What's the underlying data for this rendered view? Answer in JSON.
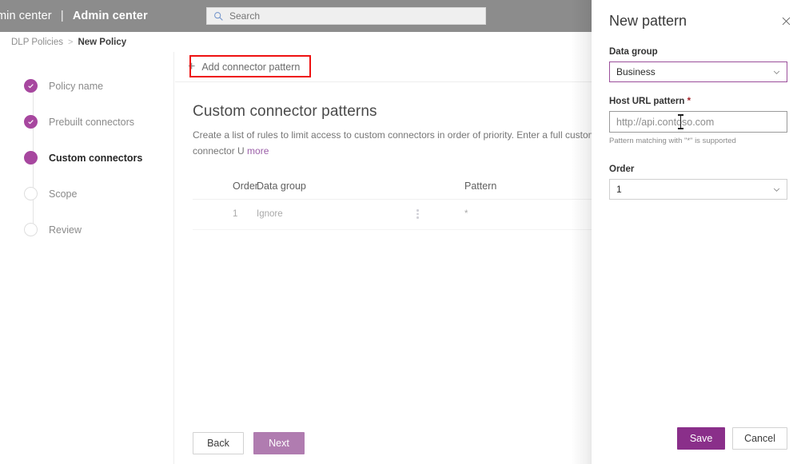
{
  "suite": {
    "title_truncated": "min center",
    "divider": "|",
    "title_bold": "Admin center"
  },
  "search": {
    "placeholder": "Search",
    "icon": "search-icon"
  },
  "breadcrumb": {
    "parent": "DLP Policies",
    "separator": ">",
    "current": "New Policy"
  },
  "wizard": {
    "steps": [
      {
        "label": "Policy name",
        "state": "done"
      },
      {
        "label": "Prebuilt connectors",
        "state": "done"
      },
      {
        "label": "Custom connectors",
        "state": "current"
      },
      {
        "label": "Scope",
        "state": "todo"
      },
      {
        "label": "Review",
        "state": "todo"
      }
    ]
  },
  "command_bar": {
    "add_pattern_label": "Add connector pattern",
    "add_icon": "plus-icon"
  },
  "main": {
    "section_title": "Custom connector patterns",
    "section_desc": "Create a list of rules to limit access to custom connectors in order of priority. Enter a full custom connector U",
    "learn_more": "more",
    "table": {
      "columns": [
        "Order",
        "Data group",
        "Pattern"
      ],
      "rows": [
        {
          "order": "1",
          "data_group": "Ignore",
          "pattern": "*"
        }
      ]
    },
    "back_label": "Back",
    "next_label": "Next"
  },
  "flyout": {
    "title": "New pattern",
    "close_icon": "close-icon",
    "data_group": {
      "label": "Data group",
      "value": "Business",
      "chevron": "chevron-down-icon"
    },
    "host_url": {
      "label": "Host URL pattern",
      "required_mark": "*",
      "placeholder": "http://api.contoso.com",
      "hint": "Pattern matching with \"*\" is supported"
    },
    "order": {
      "label": "Order",
      "value": "1",
      "chevron": "chevron-down-icon"
    },
    "save_label": "Save",
    "cancel_label": "Cancel"
  },
  "colors": {
    "accent_purple": "#a7479f",
    "save_purple": "#8a2f8a",
    "next_purple": "#b07cb0",
    "annotation_red": "#ee1111",
    "suite_gray": "#8c8c8c"
  }
}
